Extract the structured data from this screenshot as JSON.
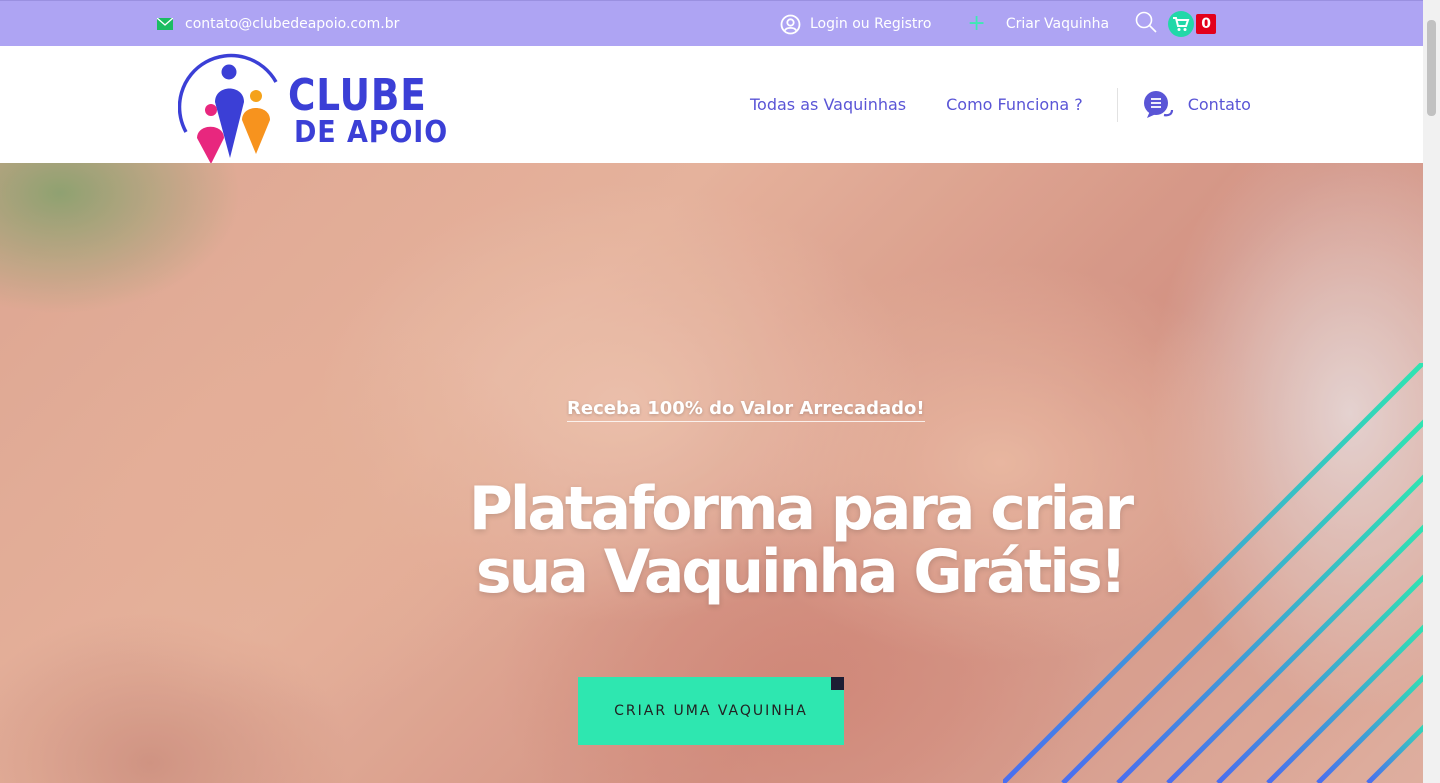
{
  "topbar": {
    "email": "contato@clubedeapoio.com.br",
    "login_label": "Login ou Registro",
    "create_label": "Criar Vaquinha",
    "cart_count": "0"
  },
  "logo": {
    "line1": "CLUBE",
    "line2": "DE APOIO"
  },
  "nav": {
    "items": [
      "Todas as Vaquinhas",
      "Como Funciona ?"
    ],
    "contact_label": "Contato"
  },
  "hero": {
    "subtitle": "Receba 100% do Valor Arrecadado!",
    "title_line1": "Plataforma para criar",
    "title_line2": "sua Vaquinha Grátis!",
    "cta_label": "CRIAR UMA VAQUINHA"
  },
  "colors": {
    "topbar_bg": "#aea4f3",
    "accent": "#2ee7b0",
    "brand": "#3b3fd6",
    "badge": "#e3001b"
  },
  "icons": [
    "mail-icon",
    "user-icon",
    "plus-icon",
    "search-icon",
    "cart-icon",
    "chat-icon"
  ]
}
